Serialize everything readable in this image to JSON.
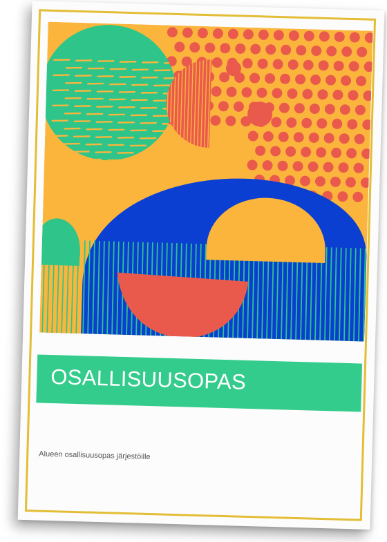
{
  "document": {
    "title": "OSALLISUUSOPAS",
    "subtitle": "Alueen osallisuusopas järjestöille"
  },
  "colors": {
    "frame": "#e3bd35",
    "title_bar": "#34cc8c",
    "art_yellow": "#fbb53c",
    "art_green": "#2ec48a",
    "art_red": "#ea5a4c",
    "art_blue": "#0a3fd2"
  }
}
